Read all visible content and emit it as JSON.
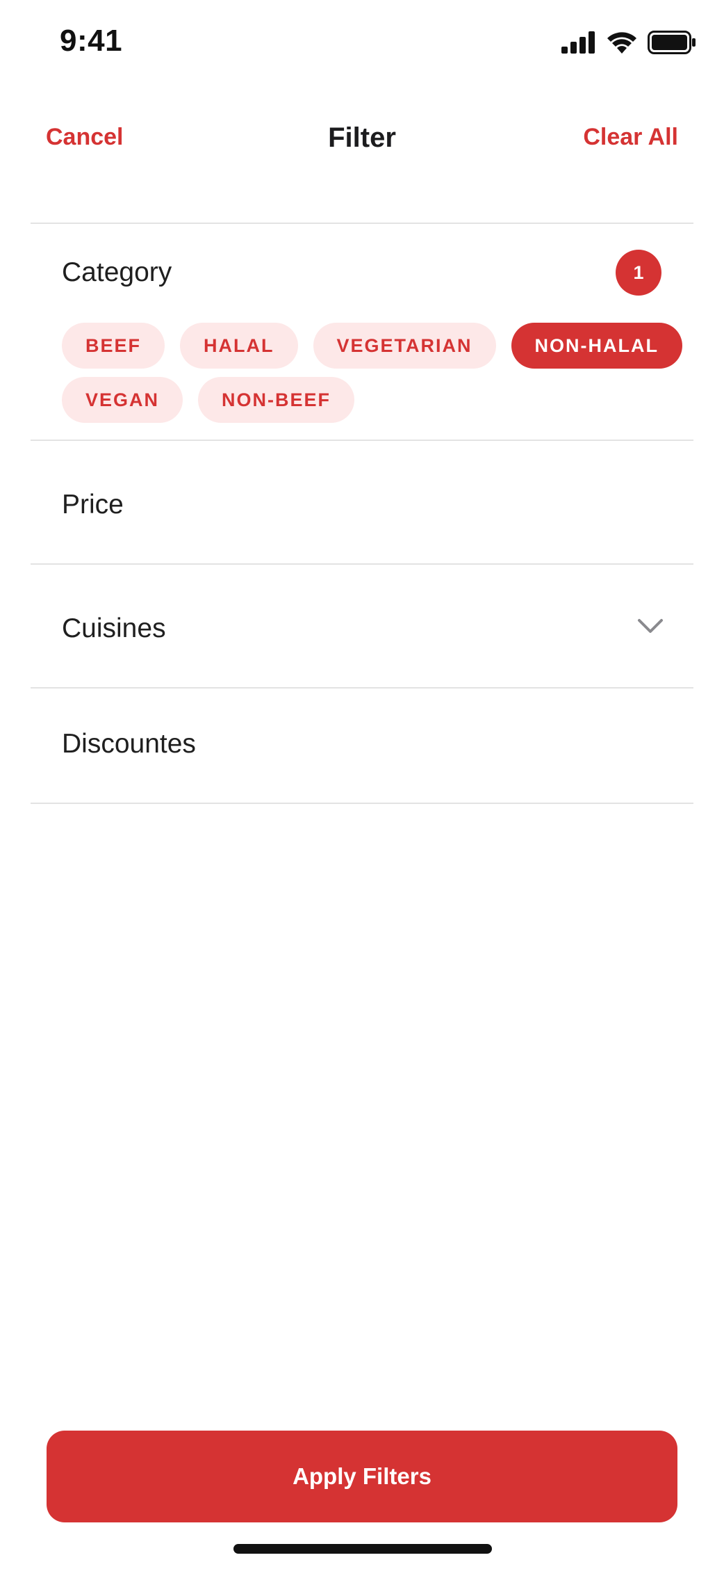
{
  "status_bar": {
    "time": "9:41",
    "icons": [
      "cellular-signal-icon",
      "wifi-icon",
      "battery-icon"
    ]
  },
  "nav": {
    "cancel_label": "Cancel",
    "title": "Filter",
    "clear_label": "Clear All"
  },
  "sections": {
    "category": {
      "title": "Category",
      "count": "1",
      "chips": [
        {
          "label": "BEEF",
          "selected": false
        },
        {
          "label": "HALAL",
          "selected": false
        },
        {
          "label": "VEGETARIAN",
          "selected": false
        },
        {
          "label": "NON-HALAL",
          "selected": true
        },
        {
          "label": "VEGAN",
          "selected": false
        },
        {
          "label": "NON-BEEF",
          "selected": false
        }
      ]
    },
    "price": {
      "title": "Price"
    },
    "cuisines": {
      "title": "Cuisines",
      "icon": "chevron-down-icon"
    },
    "discounts": {
      "title": "Discountes"
    }
  },
  "apply_label": "Apply Filters",
  "colors": {
    "accent": "#d53333",
    "chip_background": "#fde8e8",
    "divider": "#e3e3e3"
  }
}
